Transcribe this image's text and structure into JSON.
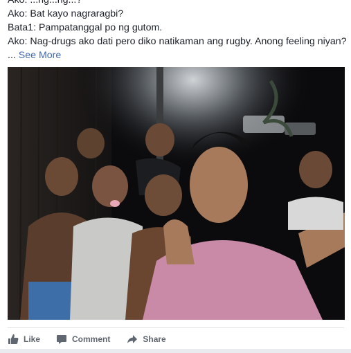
{
  "post": {
    "lines": [
      "Ako: ...ng...ng...?",
      "Ako: Bat kayo nagraragbi?",
      "Bata1: Pampatanggal po ng gutom.",
      "Ako: Nag-drugs ako dati pero diko natikaman ang rugby. Anong feeling niyan?"
    ],
    "ellipsis": "... ",
    "see_more": "See More"
  },
  "photo": {
    "description_icon": "group-selfie-photo"
  },
  "actions": {
    "like": {
      "label": "Like",
      "icon": "thumbs-up-icon"
    },
    "comment": {
      "label": "Comment",
      "icon": "speech-bubble-icon"
    },
    "share": {
      "label": "Share",
      "icon": "share-arrow-icon"
    }
  },
  "colors": {
    "link": "#4267b2",
    "action_text": "#606770",
    "body_text": "#1d2129"
  }
}
